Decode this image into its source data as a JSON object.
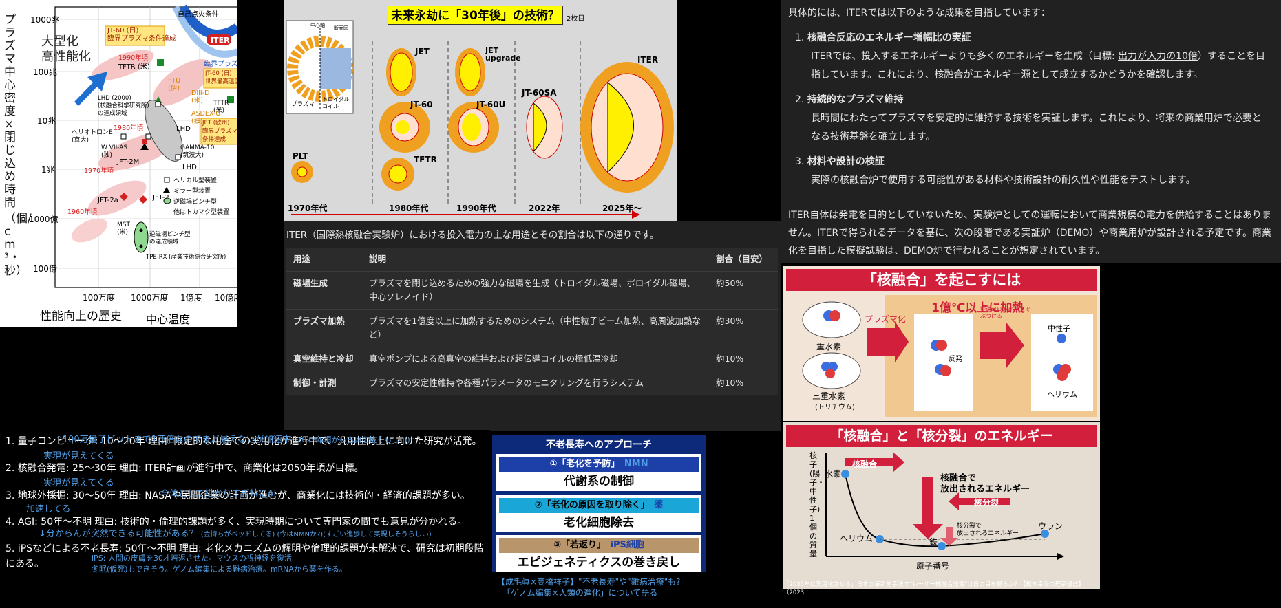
{
  "graph": {
    "y_axis_label": "プラズマ中心密度×閉じ込め時間",
    "y_unit": "（個/cm³・秒）",
    "y_ticks": [
      "1000兆",
      "100兆",
      "10兆",
      "1兆",
      "1000億",
      "100億"
    ],
    "x_ticks": [
      "100万度",
      "1000万度",
      "1億度",
      "10億度"
    ],
    "x_label": "中心温度",
    "history_label": "性能向上の歴史",
    "trend_label": "大型化\n高性能化",
    "ignition": "自己点火条件",
    "iter": "ITER",
    "critical": "臨界プラズマ条件",
    "jt60_box": "JT-60 (日)\n臨界プラズマ条件達成",
    "jt60_right": "JT-60 (日)\n世界最高温度",
    "jet": "JET (欧州)\n臨界プラズマ\n条件達成",
    "tftr": "TFTR (米)",
    "tftr2": "TFTR\n(米)",
    "y1990": "1990年頃",
    "y1980": "1980年頃",
    "y1970": "1970年頃",
    "y1960": "1960年頃",
    "ftu": "FTU\n(伊)",
    "diiid": "DIII-D\n(米)",
    "asdex": "ASDEX-U\n(独)",
    "lhd2000": "LHD (2000)\n(核融合科学研究所)\nの達成領域",
    "heliotron": "ヘリオトロンE\n(京大)",
    "w7as": "W VII-AS\n(独)",
    "lhd": "LHD",
    "jft2m": "JFT-2M",
    "gamma10": "GAMMA-10\n(筑波大)",
    "lhd3": "LHD",
    "jft2a": "JFT-2a",
    "jft2": "JFT-2",
    "mst": "MST\n(米)",
    "rfp": "逆磁場ピンチ型\nの達成領域",
    "tperx": "TPE-RX (産業技術総合研究所)",
    "legend": [
      "ヘリカル型装置",
      "ミラー型装置",
      "逆磁場ピンチ型",
      "他はトカマク型装置"
    ]
  },
  "tokamak": {
    "title": "未来永劫に「30年後」の技術？",
    "page_note": "2枚目",
    "plasma_label": "プラズマ",
    "coil_label": "トロイダル\nコイル",
    "center_label": "中心軸",
    "section_label": "断面図",
    "devices": [
      "JET",
      "JET upgrade",
      "JT-60",
      "JT-60U",
      "JT-60SA",
      "ITER",
      "PLT",
      "TFTR"
    ],
    "eras": [
      "1970年代",
      "1980年代",
      "1990年代",
      "2022年",
      "2025年〜"
    ]
  },
  "iter_text": {
    "intro": "具体的には、ITERでは以下のような成果を目指しています：",
    "items": [
      {
        "num": "1.",
        "head": "核融合反応のエネルギー増幅比の実証",
        "body_a": "ITERでは、投入するエネルギーよりも多くのエネルギーを生成（目標: ",
        "body_link": "出力が入力の10倍",
        "body_b": "）することを目指しています。これにより、核融合がエネルギー源として成立するかどうかを確認します。"
      },
      {
        "num": "2.",
        "head": "持続的なプラズマ維持",
        "body": "長時間にわたってプラズマを安定的に維持する技術を実証します。これにより、将来の商業用炉で必要となる技術基盤を確立します。"
      },
      {
        "num": "3.",
        "head": "材料や設計の検証",
        "body": "実際の核融合炉で使用する可能性がある材料や技術設計の耐久性や性能をテストします。"
      }
    ],
    "outro": "ITER自体は発電を目的としていないため、実験炉としての運転において商業規模の電力を供給することはありません。ITERで得られるデータを基に、次の段階である実証炉（DEMO）や商業用炉が設計される予定です。商業化を目指した模擬試験は、DEMO炉で行われることが想定されています。"
  },
  "power_table": {
    "intro": "ITER（国際熱核融合実験炉）における投入電力の主な用途とその割合は以下の通りです。",
    "headers": [
      "用途",
      "説明",
      "割合（目安）"
    ],
    "rows": [
      [
        "磁場生成",
        "プラズマを閉じ込めるための強力な磁場を生成（トロイダル磁場、ポロイダル磁場、中心ソレノイド）",
        "約50%"
      ],
      [
        "プラズマ加熱",
        "プラズマを1億度以上に加熱するためのシステム（中性粒子ビーム加熱、高周波加熱など）",
        "約30%"
      ],
      [
        "真空維持と冷却",
        "真空ポンプによる高真空の維持および超伝導コイルの極低温冷却",
        "約10%"
      ],
      [
        "制御・計測",
        "プラズマの安定性維持や各種パラメータのモニタリングを行うシステム",
        "約10%"
      ]
    ]
  },
  "tech_list": {
    "items": [
      {
        "num": "1.",
        "text": "量子コンピュータ: 10〜20年 理由: 限定的な用途での実用化が進行中で、汎用性向上に向けた研究が活発。",
        "note": "↑100万量子ビットまで1万倍なのでまだ見えないが加速中",
        "note_small": "(2029年頃から古典を抜くらしい)"
      },
      {
        "num": "2.",
        "text": "核融合発電: 25〜30年 理由: ITER計画が進行中で、商業化は2050年頃が目標。",
        "pre": "実現が見えてくる"
      },
      {
        "num": "3.",
        "text": "地球外採掘: 30〜50年 理由: NASAや民間企業の計画が進むが、商業化には技術的・経済的課題が多い。",
        "pre": "実現が見えてくる",
        "note": "全体として掛かりすぎ特にAI"
      },
      {
        "num": "4.",
        "text": "AGI: 50年〜不明 理由: 技術的・倫理的課題が多く、実現時期について専門家の間でも意見が分かれる。",
        "pre": "加速してる",
        "note": "↓分からんが突然できる可能性がある？",
        "note_small": "(金持ちがベッドしてる) (今はNMNか?)(すごい進歩して実現しそうらしい)"
      },
      {
        "num": "5.",
        "text": "iPSなどによる不老長寿: 50年〜不明 理由: 老化メカニズムの解明や倫理的課題が未解決で、研究は初期段階にある。",
        "note": "iPS: 人間の皮膚を30才若返させた。マウスの視神経を復活",
        "note2": "冬眠(仮死)もできそう。ゲノム編集による難病治療。mRNAから薬を作る。"
      }
    ]
  },
  "longevity": {
    "title": "不老長寿へのアプローチ",
    "a_bar": "①「老化を予防」",
    "a_note": "NMN",
    "a_big": "代謝系の制御",
    "b_bar": "②「老化の原因を取り除く」",
    "b_note": "薬",
    "b_big": "老化細胞除去",
    "c_bar": "③「若返り」",
    "c_note": "iPS細胞",
    "c_big": "エピジェネティクスの巻き戻し",
    "caption1": "【成毛眞×高橋祥子】\"不老長寿\"や\"難病治療\"も?",
    "caption2": "「ゲノム編集×人類の進化」について語る",
    "colors": {
      "bar_a": "#1c3fa8",
      "bar_b": "#1aa7d8",
      "bar_c": "#b8956a"
    }
  },
  "fusion": {
    "title": "「核融合」を起こすには",
    "heat": "1億℃以上に加熱",
    "deuterium": "重水素",
    "tritium": "三重水素",
    "tritium_sub": "(トリチウム)",
    "plasma": "プラズマ化",
    "speed": "秒速1000km以上で\nぶつける",
    "repel": "反発",
    "neutron": "中性子",
    "helium": "ヘリウム"
  },
  "energy": {
    "title": "「核融合」と「核分裂」のエネルギー",
    "y_label": "核子(陽子・中性子)1個の質量",
    "x_label": "原子番号",
    "fusion_tag": "核融合",
    "fission_tag": "核分裂",
    "fusion_note": "核融合で\n放出されるエネルギー",
    "fission_note": "核分裂で\n放出されるエネルギー",
    "hydrogen": "水素",
    "helium": "ヘリウム",
    "iron": "鉄",
    "uranium": "ウラン",
    "caption": "「2035年に実用化させる」日本の革新的手法で\"レーザー核融合発電\"は日の目を見るか？【橋本幸治の理系通信】（2023"
  }
}
